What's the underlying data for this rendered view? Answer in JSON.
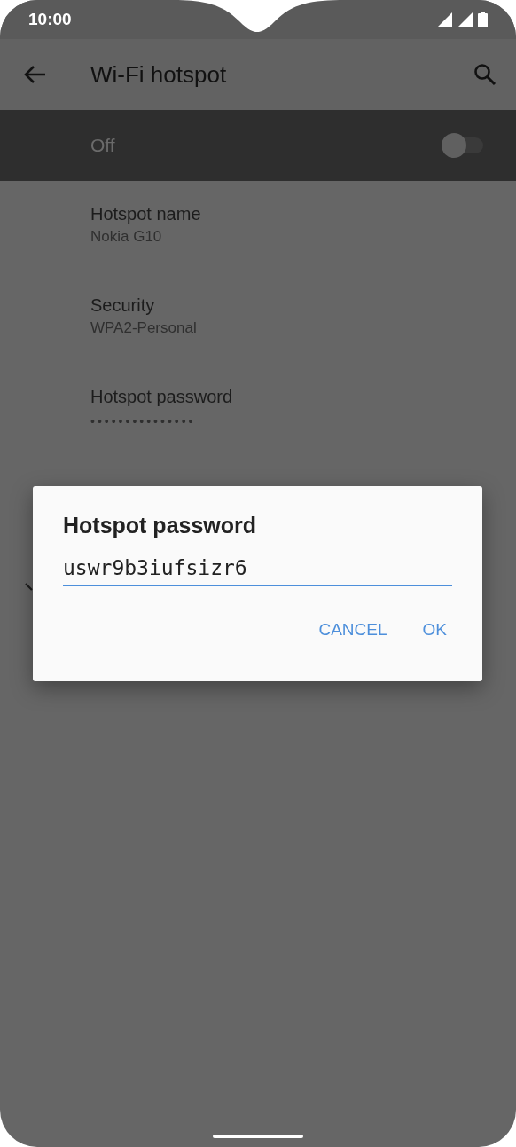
{
  "status_bar": {
    "time": "10:00"
  },
  "app_bar": {
    "title": "Wi-Fi hotspot"
  },
  "master_switch": {
    "label": "Off",
    "on": false
  },
  "settings": [
    {
      "title": "Hotspot name",
      "summary": "Nokia G10",
      "kind": "text"
    },
    {
      "title": "Security",
      "summary": "WPA2-Personal",
      "kind": "text"
    },
    {
      "title": "Hotspot password",
      "summary": "•••••••••••••••",
      "kind": "dots"
    }
  ],
  "dialog": {
    "title": "Hotspot password",
    "value": "uswr9b3iufsizr6",
    "buttons": [
      "CANCEL",
      "OK"
    ]
  }
}
